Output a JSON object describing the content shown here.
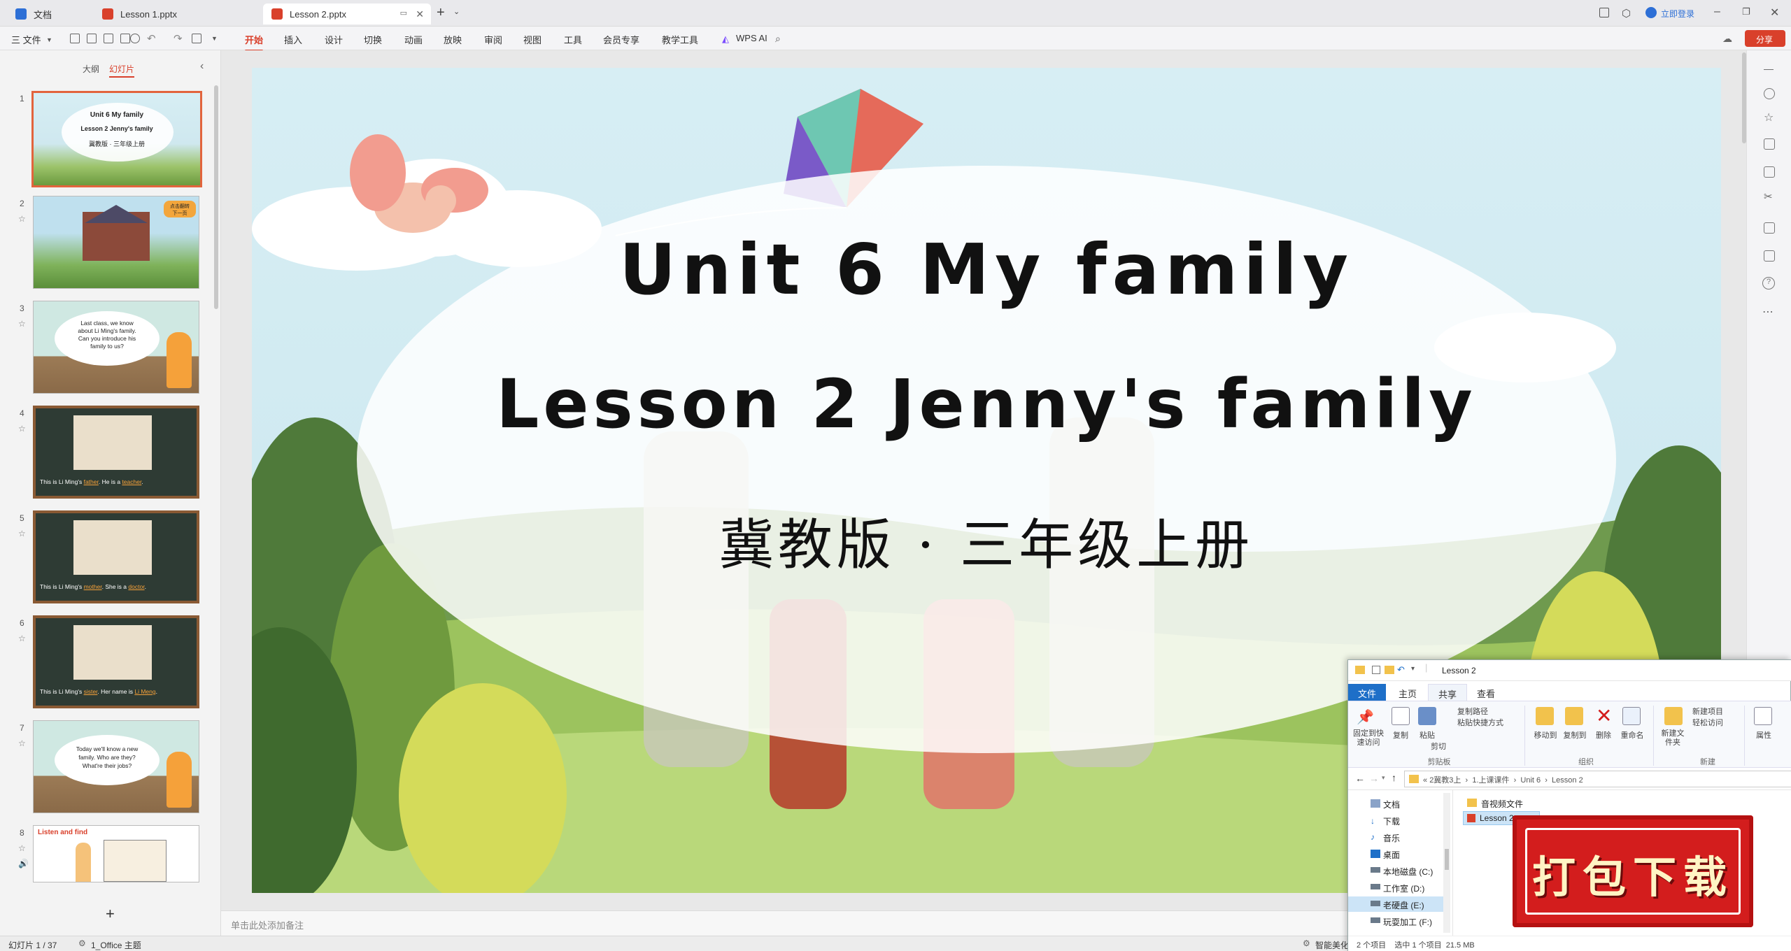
{
  "tabs": [
    {
      "label": "文档",
      "color": "#2d6fd6"
    },
    {
      "label": "Lesson 1.pptx",
      "color": "#d9402b"
    },
    {
      "label": "Lesson 2.pptx",
      "color": "#d9402b"
    }
  ],
  "titlebar_right": {
    "login": "立即登录"
  },
  "menu": {
    "file": "三 文件",
    "items": [
      "开始",
      "插入",
      "设计",
      "切换",
      "动画",
      "放映",
      "审阅",
      "视图",
      "工具",
      "会员专享",
      "教学工具"
    ],
    "wps_ai": "WPS AI",
    "share": "分享"
  },
  "left_panel": {
    "tab_outline": "大纲",
    "tab_slides": "幻灯片",
    "add": "+",
    "thumbs": [
      {
        "num": "1",
        "lines": [
          "Unit 6 My family",
          "Lesson 2 Jenny's family",
          "冀教版 · 三年级上册"
        ]
      },
      {
        "num": "2",
        "lines": [
          "点击翻转",
          "下一页"
        ]
      },
      {
        "num": "3",
        "lines": [
          "Last class, we know",
          "about Li Ming's family.",
          "Can you introduce his",
          "family to us?"
        ]
      },
      {
        "num": "4",
        "lines": [
          "This is Li Ming's",
          "father",
          "He is a",
          "teacher"
        ]
      },
      {
        "num": "5",
        "lines": [
          "This is Li Ming's",
          "mother",
          "She is a",
          "doctor"
        ]
      },
      {
        "num": "6",
        "lines": [
          "This is Li Ming's",
          "sister",
          "Her name is",
          "Li Meng"
        ]
      },
      {
        "num": "7",
        "lines": [
          "Today we'll know a new",
          "family. Who are they?",
          "What're their jobs?"
        ]
      },
      {
        "num": "8",
        "lines": [
          "Listen and find"
        ]
      }
    ]
  },
  "slide": {
    "title": "Unit 6 My family",
    "subtitle": "Lesson 2 Jenny's family",
    "edition": "冀教版 · 三年级上册"
  },
  "notes_placeholder": "单击此处添加备注",
  "status": {
    "slide_count": "幻灯片 1 / 37",
    "theme": "1_Office 主题",
    "smart": "智能美化"
  },
  "explorer": {
    "title": "Lesson 2",
    "tabs": [
      "文件",
      "主页",
      "共享",
      "查看"
    ],
    "ribbon": {
      "pin": "固定到快速访问",
      "copy": "复制",
      "paste": "粘贴",
      "copy_path": "复制路径",
      "paste_shortcut": "粘贴快捷方式",
      "cut": "剪切",
      "clipboard": "剪贴板",
      "move_to": "移动到",
      "copy_to": "复制到",
      "delete": "删除",
      "rename": "重命名",
      "organize": "组织",
      "new_folder": "新建文件夹",
      "new_item": "新建项目",
      "easy_access": "轻松访问",
      "new": "新建",
      "properties": "属性"
    },
    "breadcrumb": [
      "2冀教3上",
      "1.上课课件",
      "Unit 6",
      "Lesson 2"
    ],
    "tree": [
      "文档",
      "下载",
      "音乐",
      "桌面",
      "本地磁盘 (C:)",
      "工作室 (D:)",
      "老硬盘 (E:)",
      "玩耍加工 (F:)"
    ],
    "files": [
      "音视频文件",
      "Lesson 2.pptx"
    ],
    "status": "2 个项目    选中 1 个项目  21.5 MB"
  },
  "badge": {
    "text": "打包下载"
  }
}
